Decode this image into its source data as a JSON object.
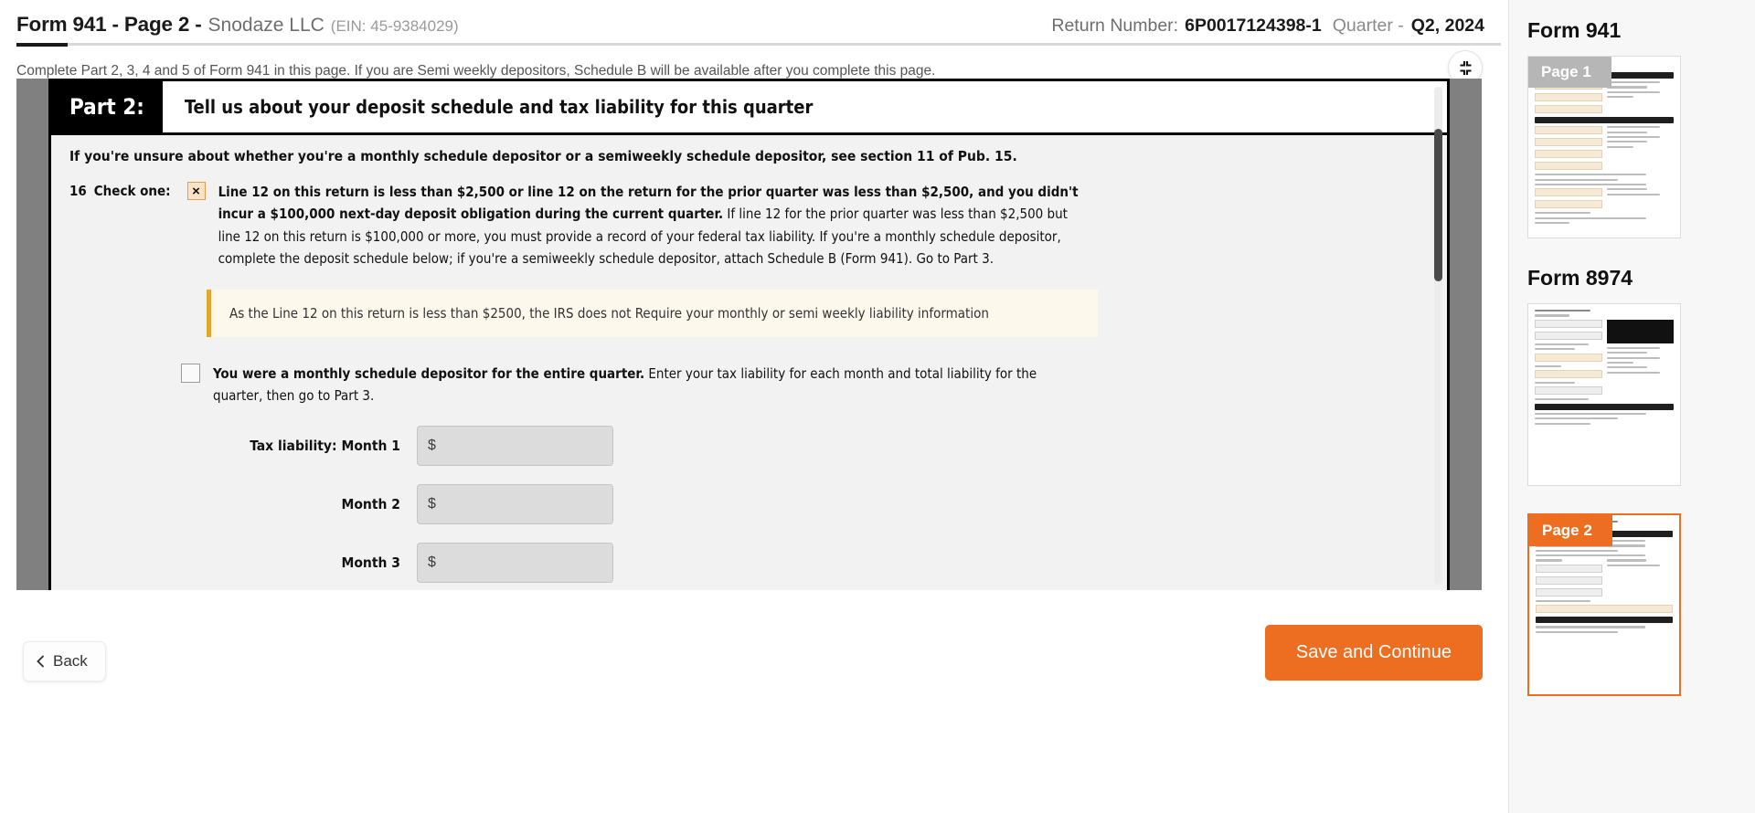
{
  "header": {
    "form_title": "Form 941 - Page 2 -",
    "company": "Snodaze LLC",
    "ein": "(EIN: 45-9384029)",
    "return_number_label": "Return Number:",
    "return_number": "6P0017124398-1",
    "quarter_label": "Quarter -",
    "quarter_value": "Q2, 2024",
    "subtitle": "Complete Part 2, 3, 4 and 5 of Form 941 in this page. If you are Semi weekly depositors, Schedule B will be available after you complete this page.",
    "expand_icon": "compress-icon"
  },
  "form": {
    "part_tag": "Part 2:",
    "part_title": "Tell us about your deposit schedule and tax liability for this quarter",
    "hint": "If you're unsure about whether you're a monthly schedule depositor or a semiweekly schedule depositor, see section 11 of Pub. 15.",
    "line16": {
      "number": "16",
      "label": "Check one:",
      "checkbox_mark": "×",
      "bold_part": "Line 12 on this return is less than $2,500 or line 12 on the return for the prior quarter was less than $2,500, and you didn't incur a $100,000 next-day deposit obligation during the current quarter.",
      "rest": " If line 12 for the prior quarter was less than $2,500 but line 12 on this return is $100,000 or more, you must provide a record of your federal tax liability. If you're a monthly schedule depositor, complete the deposit schedule below; if you're a semiweekly schedule depositor, attach Schedule B (Form 941). Go to Part 3."
    },
    "notice": "As the Line 12 on this return is less than $2500, the IRS does not Require your monthly or semi weekly liability information",
    "monthly": {
      "bold_part": "You were a monthly schedule depositor for the entire quarter.",
      "rest": " Enter your tax liability for each month and total liability for the quarter, then go to Part 3."
    },
    "fields": [
      {
        "label": "Tax liability: Month 1",
        "prefix": "$",
        "value": ""
      },
      {
        "label": "Month 2",
        "prefix": "$",
        "value": ""
      },
      {
        "label": "Month 3",
        "prefix": "$",
        "value": ""
      }
    ]
  },
  "footer": {
    "back_label": "Back",
    "back_icon": "chevron-left-icon",
    "save_label": "Save and Continue"
  },
  "sidebar": {
    "sections": [
      {
        "heading": "Form 941",
        "thumbs": [
          {
            "tag": "Page 1",
            "selected": false
          }
        ]
      },
      {
        "heading": "Form 8974",
        "thumbs": [
          {
            "tag": "",
            "selected": false
          }
        ]
      },
      {
        "heading": "",
        "thumbs": [
          {
            "tag": "Page 2",
            "selected": true
          }
        ]
      }
    ]
  },
  "colors": {
    "accent": "#ED6E20",
    "notice_border": "#e0a82e",
    "notice_bg": "#fdf8ec",
    "checked_box_bg": "#fce3c6",
    "checked_box_border": "#e79b4b"
  }
}
